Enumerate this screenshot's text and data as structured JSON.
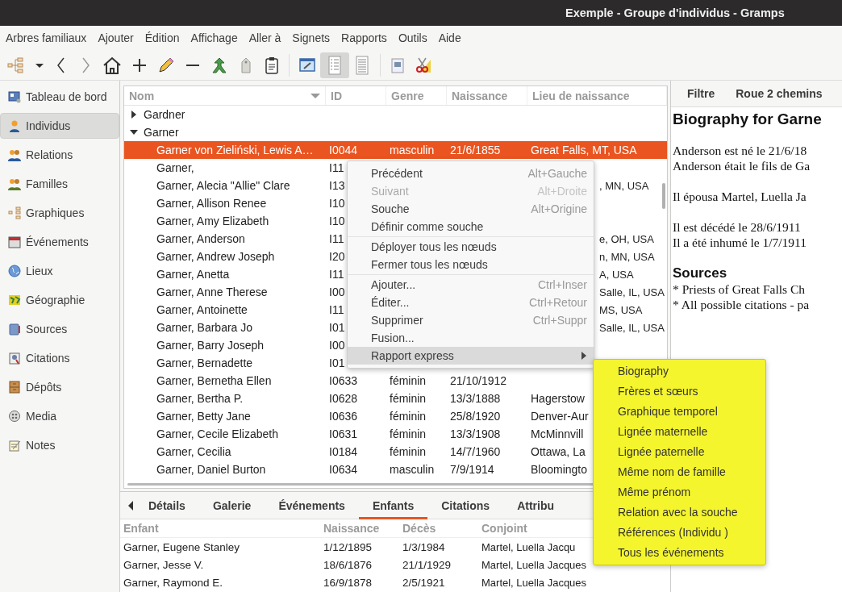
{
  "window": {
    "title": "Exemple - Groupe d'individus - Gramps"
  },
  "menu_bar": [
    "Arbres familiaux",
    "Ajouter",
    "Édition",
    "Affichage",
    "Aller à",
    "Signets",
    "Rapports",
    "Outils",
    "Aide"
  ],
  "toolbar": {
    "views": [
      {
        "selected": true
      },
      {
        "selected": false
      }
    ]
  },
  "sidebar": {
    "items": [
      {
        "label": "Tableau de bord",
        "selected": false
      },
      {
        "label": "Individus",
        "selected": true
      },
      {
        "label": "Relations",
        "selected": false
      },
      {
        "label": "Familles",
        "selected": false
      },
      {
        "label": "Graphiques",
        "selected": false
      },
      {
        "label": "Événements",
        "selected": false
      },
      {
        "label": "Lieux",
        "selected": false
      },
      {
        "label": "Géographie",
        "selected": false
      },
      {
        "label": "Sources",
        "selected": false
      },
      {
        "label": "Citations",
        "selected": false
      },
      {
        "label": "Dépôts",
        "selected": false
      },
      {
        "label": "Media",
        "selected": false
      },
      {
        "label": "Notes",
        "selected": false
      }
    ]
  },
  "people_table": {
    "columns": [
      "Nom",
      "ID",
      "Genre",
      "Naissance",
      "Lieu de naissance"
    ],
    "groups": [
      {
        "surname": "Gardner",
        "expanded": false
      },
      {
        "surname": "Garner",
        "expanded": true,
        "children": [
          {
            "name": "Garner von Zieliński, Lewis A…",
            "id": "I0044",
            "gender": "masculin",
            "birth": "21/6/1855",
            "birthplace": "Great Falls, MT, USA",
            "selected": true
          },
          {
            "name": "Garner,",
            "id": "I11",
            "selected": false
          },
          {
            "name": "Garner, Alecia \"Allie\" Clare",
            "id": "I13",
            "birthplace": ", MN, USA",
            "selected": false
          },
          {
            "name": "Garner, Allison Renee",
            "id": "I10",
            "selected": false
          },
          {
            "name": "Garner, Amy Elizabeth",
            "id": "I10",
            "selected": false
          },
          {
            "name": "Garner, Anderson",
            "id": "I11",
            "birthplace": "e, OH, USA",
            "selected": false
          },
          {
            "name": "Garner, Andrew Joseph",
            "id": "I20",
            "birthplace": "n, MN, USA",
            "selected": false
          },
          {
            "name": "Garner, Anetta",
            "id": "I11",
            "birthplace": "A, USA",
            "selected": false
          },
          {
            "name": "Garner, Anne Therese",
            "id": "I00",
            "birthplace": "Salle, IL, USA",
            "selected": false
          },
          {
            "name": "Garner, Antoinette",
            "id": "I11",
            "birthplace": "MS, USA",
            "selected": false
          },
          {
            "name": "Garner, Barbara Jo",
            "id": "I01",
            "birthplace": "Salle, IL, USA",
            "selected": false
          },
          {
            "name": "Garner, Barry Joseph",
            "id": "I00",
            "selected": false
          },
          {
            "name": "Garner, Bernadette",
            "id": "I01",
            "selected": false
          },
          {
            "name": "Garner, Bernetha Ellen",
            "id": "I0633",
            "gender": "féminin",
            "birth": "21/10/1912",
            "selected": false
          },
          {
            "name": "Garner, Bertha P.",
            "id": "I0628",
            "gender": "féminin",
            "birth": "13/3/1888",
            "birthplace": "Hagerstow",
            "selected": false
          },
          {
            "name": "Garner, Betty Jane",
            "id": "I0636",
            "gender": "féminin",
            "birth": "25/8/1920",
            "birthplace": "Denver-Aur",
            "selected": false
          },
          {
            "name": "Garner, Cecile Elizabeth",
            "id": "I0631",
            "gender": "féminin",
            "birth": "13/3/1908",
            "birthplace": "McMinnvill",
            "selected": false
          },
          {
            "name": "Garner, Cecilia",
            "id": "I0184",
            "gender": "féminin",
            "birth": "14/7/1960",
            "birthplace": "Ottawa, La",
            "selected": false
          },
          {
            "name": "Garner, Daniel Burton",
            "id": "I0634",
            "gender": "masculin",
            "birth": "7/9/1914",
            "birthplace": "Bloomingto",
            "selected": false
          }
        ]
      }
    ]
  },
  "context_menu": {
    "items": [
      {
        "kind": "item",
        "label": "Précédent",
        "shortcut": "Alt+Gauche",
        "disabled": false,
        "selected": false
      },
      {
        "kind": "item",
        "label": "Suivant",
        "shortcut": "Alt+Droite",
        "disabled": true,
        "selected": false
      },
      {
        "kind": "item",
        "label": "Souche",
        "shortcut": "Alt+Origine",
        "disabled": false,
        "selected": false
      },
      {
        "kind": "item",
        "label": "Définir comme souche",
        "disabled": false,
        "selected": false
      },
      {
        "kind": "separator"
      },
      {
        "kind": "item",
        "label": "Déployer tous les nœuds",
        "disabled": false,
        "selected": false
      },
      {
        "kind": "item",
        "label": "Fermer tous les nœuds",
        "disabled": false,
        "selected": false
      },
      {
        "kind": "separator"
      },
      {
        "kind": "item",
        "label": "Ajouter...",
        "shortcut": "Ctrl+Inser",
        "disabled": false,
        "selected": false
      },
      {
        "kind": "item",
        "label": "Éditer...",
        "shortcut": "Ctrl+Retour",
        "disabled": false,
        "selected": false
      },
      {
        "kind": "item",
        "label": "Supprimer",
        "shortcut": "Ctrl+Suppr",
        "disabled": false,
        "selected": false
      },
      {
        "kind": "item",
        "label": "Fusion...",
        "disabled": false,
        "selected": false
      },
      {
        "kind": "submenu",
        "label": "Rapport express",
        "disabled": false,
        "selected": true
      }
    ]
  },
  "submenu": {
    "items": [
      "Biography",
      "Frères et sœurs",
      "Graphique temporel",
      "Lignée maternelle",
      "Lignée paternelle",
      "Même nom de famille",
      "Même prénom",
      "Relation avec la souche",
      "Références (Individu )",
      "Tous les événements"
    ]
  },
  "bottom_tabs": [
    {
      "label": "Détails",
      "selected": false
    },
    {
      "label": "Galerie",
      "selected": false
    },
    {
      "label": "Événements",
      "selected": false
    },
    {
      "label": "Enfants",
      "selected": true
    },
    {
      "label": "Citations",
      "selected": false
    },
    {
      "label": "Attribu",
      "selected": false
    }
  ],
  "children_table": {
    "columns": [
      "Enfant",
      "Naissance",
      "Décès",
      "Conjoint"
    ],
    "rows": [
      [
        "Garner, Eugene Stanley",
        "1/12/1895",
        "1/3/1984",
        "Martel, Luella Jacqu"
      ],
      [
        "Garner, Jesse V.",
        "18/6/1876",
        "21/1/1929",
        "Martel, Luella Jacques"
      ],
      [
        "Garner, Raymond E.",
        "16/9/1878",
        "2/5/1921",
        "Martel, Luella Jacques"
      ]
    ]
  },
  "gramplet": {
    "tabs": [
      "Filtre",
      "Roue 2 chemins"
    ],
    "title": "Biography for Garne",
    "paragraphs": [
      [
        "Anderson est né le 21/6/18",
        "Anderson était le fils de Ga"
      ],
      [
        "Il épousa Martel, Luella Ja"
      ],
      [
        "Il est décédé le 28/6/1911",
        "Il a été inhumé le 1/7/1911"
      ]
    ],
    "sources_heading": "Sources",
    "sources": [
      "* Priests of Great Falls Ch",
      "* All possible citations - pa"
    ]
  }
}
